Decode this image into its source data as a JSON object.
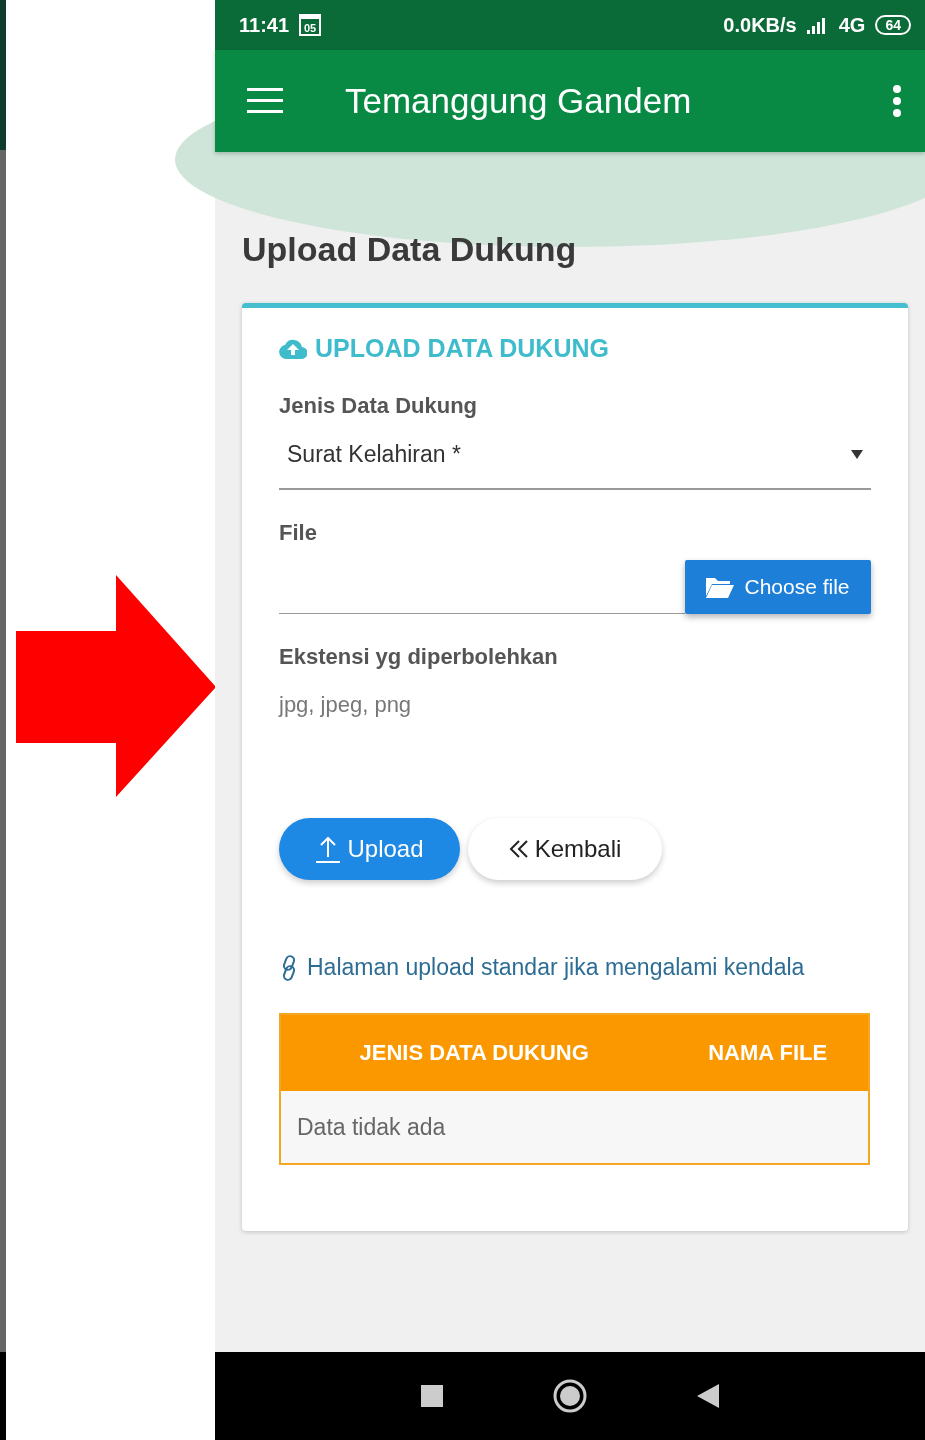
{
  "status_bar": {
    "time": "11:41",
    "calendar_day": "05",
    "net_speed": "0.0KB/s",
    "network": "4G",
    "battery": "64"
  },
  "app_bar": {
    "title": "Temanggung Gandem"
  },
  "page_title": "Upload Data Dukung",
  "card": {
    "heading": "UPLOAD DATA DUKUNG",
    "type_field": {
      "label": "Jenis Data Dukung",
      "value": "Surat Kelahiran *"
    },
    "file_field": {
      "label": "File",
      "button": "Choose file"
    },
    "extensions": {
      "label": "Ekstensi yg diperbolehkan",
      "value": "jpg, jpeg, png"
    },
    "buttons": [
      {
        "kind": "primary",
        "label": "Upload"
      },
      {
        "kind": "secondary",
        "label": "Kembali"
      }
    ],
    "link": "Halaman upload standar jika mengalami kendala",
    "table": {
      "columns": [
        "JENIS DATA DUKUNG",
        "NAMA FILE"
      ],
      "empty_message": "Data tidak ada"
    }
  }
}
